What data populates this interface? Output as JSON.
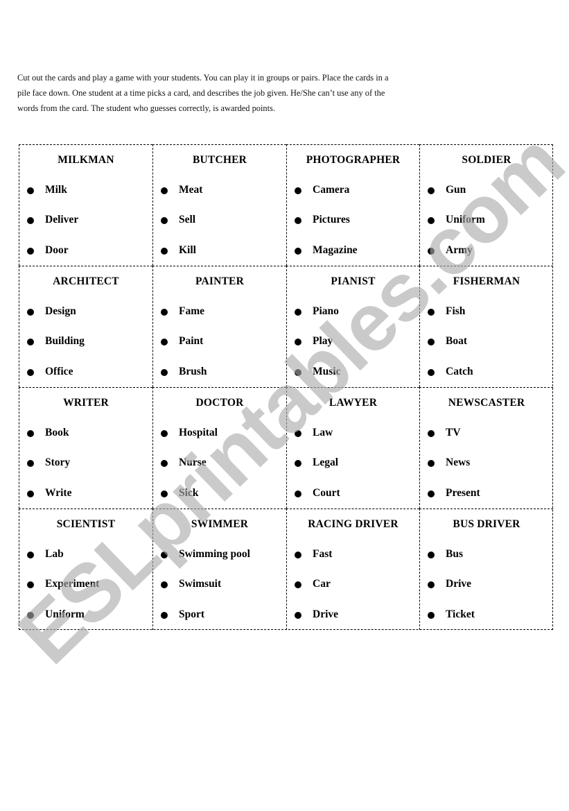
{
  "instructions": {
    "lines": [
      "Cut out the cards and play a game with your students.  You can play it in groups or pairs.  Place the cards in a",
      "pile face down. One student at a time picks a card, and describes the job given. He/She can’t use any of the",
      "words from the card. The student who guesses correctly, is awarded points."
    ]
  },
  "bullet_icon": "filled-circle-bullet",
  "cards": [
    {
      "title": "MILKMAN",
      "words": [
        "Milk",
        "Deliver",
        "Door"
      ]
    },
    {
      "title": "BUTCHER",
      "words": [
        "Meat",
        "Sell",
        "Kill"
      ]
    },
    {
      "title": "PHOTOGRAPHER",
      "words": [
        "Camera",
        "Pictures",
        "Magazine"
      ]
    },
    {
      "title": "SOLDIER",
      "words": [
        "Gun",
        "Uniform",
        "Army"
      ]
    },
    {
      "title": "ARCHITECT",
      "words": [
        "Design",
        "Building",
        "Office"
      ]
    },
    {
      "title": "PAINTER",
      "words": [
        "Fame",
        "Paint",
        "Brush"
      ]
    },
    {
      "title": "PIANIST",
      "words": [
        "Piano",
        "Play",
        "Music"
      ]
    },
    {
      "title": "FISHERMAN",
      "words": [
        "Fish",
        "Boat",
        "Catch"
      ]
    },
    {
      "title": "WRITER",
      "words": [
        "Book",
        "Story",
        "Write"
      ]
    },
    {
      "title": "DOCTOR",
      "words": [
        "Hospital",
        "Nurse",
        "Sick"
      ]
    },
    {
      "title": "LAWYER",
      "words": [
        "Law",
        "Legal",
        "Court"
      ]
    },
    {
      "title": "NEWSCASTER",
      "words": [
        "TV",
        "News",
        "Present"
      ]
    },
    {
      "title": "SCIENTIST",
      "words": [
        "Lab",
        "Experiment",
        "Uniform"
      ]
    },
    {
      "title": "SWIMMER",
      "words": [
        "Swimming pool",
        "Swimsuit",
        "Sport"
      ]
    },
    {
      "title": "RACING DRIVER",
      "words": [
        "Fast",
        "Car",
        "Drive"
      ]
    },
    {
      "title": "BUS DRIVER",
      "words": [
        "Bus",
        "Drive",
        "Ticket"
      ]
    }
  ],
  "watermark": {
    "text": "ESLprintables.com",
    "color": "#c4c4c4"
  }
}
